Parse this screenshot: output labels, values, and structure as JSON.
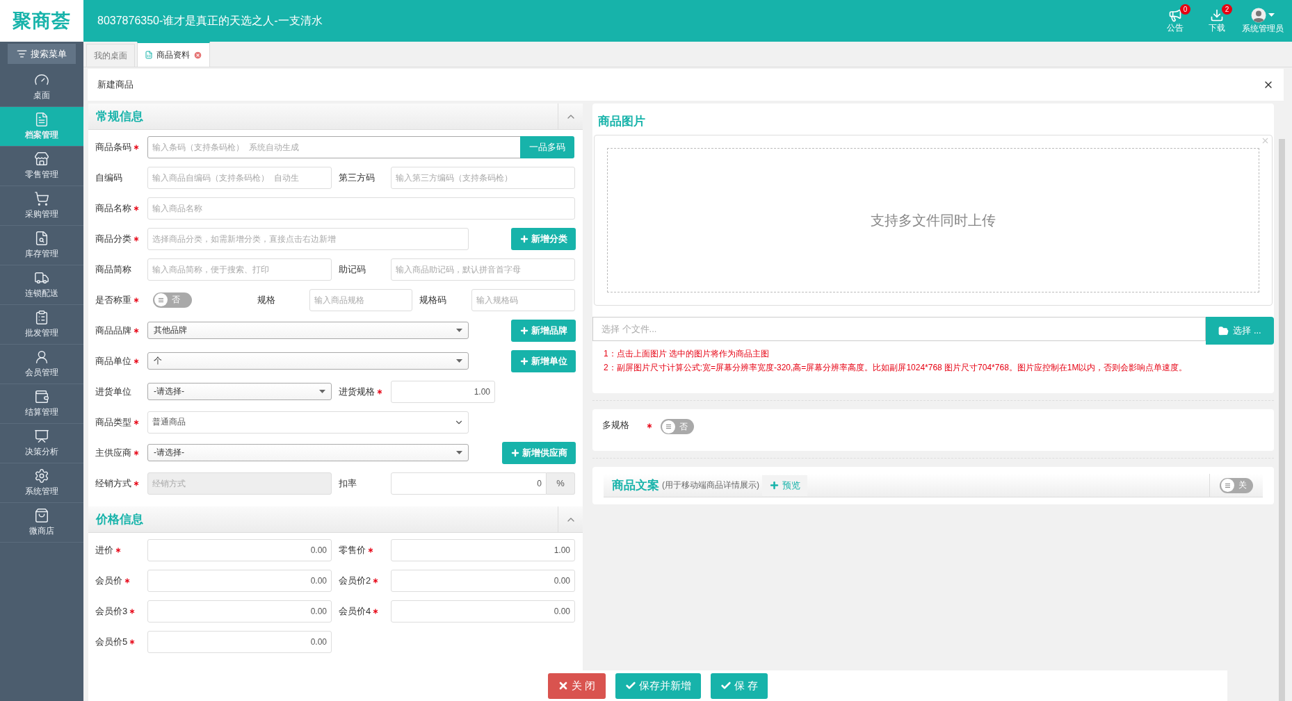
{
  "header": {
    "logo": "聚商荟",
    "title": "8037876350-谁才是真正的天选之人-一支清水",
    "actions": [
      {
        "label": "公告",
        "badge": "0"
      },
      {
        "label": "下载",
        "badge": "2"
      }
    ],
    "user": {
      "label": "系统管理员"
    }
  },
  "sidebar": {
    "search": "搜索菜单",
    "items": [
      {
        "label": "桌面",
        "selected": false
      },
      {
        "label": "档案管理",
        "selected": true
      },
      {
        "label": "零售管理",
        "selected": false
      },
      {
        "label": "采购管理",
        "selected": false
      },
      {
        "label": "库存管理",
        "selected": false
      },
      {
        "label": "连锁配送",
        "selected": false
      },
      {
        "label": "批发管理",
        "selected": false
      },
      {
        "label": "会员管理",
        "selected": false
      },
      {
        "label": "结算管理",
        "selected": false
      },
      {
        "label": "决策分析",
        "selected": false
      },
      {
        "label": "系统管理",
        "selected": false
      },
      {
        "label": "微商店",
        "selected": false
      }
    ]
  },
  "tabs": [
    {
      "label": "我的桌面",
      "selected": false,
      "closable": false
    },
    {
      "label": "商品资料",
      "selected": true,
      "closable": true
    }
  ],
  "panel": {
    "title": "新建商品"
  },
  "sections": [
    {
      "title": "常规信息",
      "expanded": true,
      "rows": [
        {
          "kind": "barcode",
          "fields": [
            {
              "label": "商品条码",
              "required": true,
              "control": {
                "kind": "input",
                "placeholder": "输入条码（支持条码枪）  系统自动生成"
              }
            }
          ],
          "button": "一品多码"
        },
        {
          "kind": "pair",
          "fields": [
            {
              "label": "自编码",
              "required": false,
              "control": {
                "kind": "input",
                "placeholder": "输入商品自编码（支持条码枪）  自动生"
              }
            },
            {
              "label": "第三方码",
              "required": false,
              "control": {
                "kind": "input",
                "placeholder": "输入第三方编码（支持条码枪）"
              }
            }
          ]
        },
        {
          "kind": "full",
          "fields": [
            {
              "label": "商品名称",
              "required": true,
              "control": {
                "kind": "input",
                "placeholder": "输入商品名称"
              }
            }
          ]
        },
        {
          "kind": "with-button",
          "fields": [
            {
              "label": "商品分类",
              "required": true,
              "control": {
                "kind": "input",
                "placeholder": "选择商品分类，如需新增分类，直接点击右边新增"
              }
            }
          ],
          "button": "新增分类"
        },
        {
          "kind": "pair",
          "fields": [
            {
              "label": "商品简称",
              "required": false,
              "control": {
                "kind": "input",
                "placeholder": "输入商品简称，便于搜索、打印"
              }
            },
            {
              "label": "助记码",
              "required": false,
              "control": {
                "kind": "input",
                "placeholder": "输入商品助记码，默认拼音首字母"
              }
            }
          ]
        },
        {
          "kind": "toggle-spec",
          "fields": [
            {
              "label": "是否称重",
              "required": true,
              "control": {
                "kind": "toggle",
                "on": false,
                "text": "否"
              }
            },
            {
              "label": "规格",
              "required": false,
              "control": {
                "kind": "input",
                "placeholder": "输入商品规格"
              }
            },
            {
              "label": "规格码",
              "required": false,
              "control": {
                "kind": "input",
                "placeholder": "输入规格码"
              }
            }
          ]
        },
        {
          "kind": "with-button",
          "fields": [
            {
              "label": "商品品牌",
              "required": true,
              "control": {
                "kind": "select",
                "value": "其他品牌"
              }
            }
          ],
          "button": "新增品牌"
        },
        {
          "kind": "with-button",
          "fields": [
            {
              "label": "商品单位",
              "required": true,
              "control": {
                "kind": "select",
                "value": "个"
              }
            }
          ],
          "button": "新增单位"
        },
        {
          "kind": "pair",
          "fields": [
            {
              "label": "进货单位",
              "required": false,
              "control": {
                "kind": "select",
                "value": "-请选择-"
              }
            },
            {
              "label": "进货规格",
              "required": true,
              "control": {
                "kind": "number",
                "value": "1.00"
              }
            }
          ]
        },
        {
          "kind": "with-button",
          "fields": [
            {
              "label": "商品类型",
              "required": true,
              "control": {
                "kind": "native-select",
                "value": "普通商品"
              }
            }
          ]
        },
        {
          "kind": "with-button",
          "fields": [
            {
              "label": "主供应商",
              "required": true,
              "control": {
                "kind": "select",
                "value": "-请选择-"
              }
            }
          ],
          "button": "新增供应商"
        },
        {
          "kind": "pair",
          "fields": [
            {
              "label": "经销方式",
              "required": true,
              "control": {
                "kind": "disabled",
                "placeholder": "经销方式"
              }
            },
            {
              "label": "扣率",
              "required": false,
              "control": {
                "kind": "percent",
                "value": "0",
                "addon": "%"
              }
            }
          ]
        }
      ]
    },
    {
      "title": "价格信息",
      "expanded": true,
      "rows": [
        {
          "kind": "pair",
          "fields": [
            {
              "label": "进价",
              "required": true,
              "control": {
                "kind": "number",
                "value": "0.00"
              }
            },
            {
              "label": "零售价",
              "required": true,
              "control": {
                "kind": "number",
                "value": "1.00"
              }
            }
          ]
        },
        {
          "kind": "pair",
          "fields": [
            {
              "label": "会员价",
              "required": true,
              "control": {
                "kind": "number",
                "value": "0.00"
              }
            },
            {
              "label": "会员价2",
              "required": true,
              "control": {
                "kind": "number",
                "value": "0.00"
              }
            }
          ]
        },
        {
          "kind": "pair",
          "fields": [
            {
              "label": "会员价3",
              "required": true,
              "control": {
                "kind": "number",
                "value": "0.00"
              }
            },
            {
              "label": "会员价4",
              "required": true,
              "control": {
                "kind": "number",
                "value": "0.00"
              }
            }
          ]
        },
        {
          "kind": "half",
          "fields": [
            {
              "label": "会员价5",
              "required": true,
              "control": {
                "kind": "number",
                "value": "0.00"
              }
            }
          ]
        }
      ]
    }
  ],
  "image_panel": {
    "title": "商品图片",
    "dropzone": "支持多文件同时上传",
    "file_placeholder": "选择 个文件...",
    "choose_button": "选择 ...",
    "notes": [
      "1：点击上面图片 选中的图片将作为商品主图",
      "2：副屏图片尺寸计算公式:宽=屏幕分辨率宽度-320,高=屏幕分辨率高度。比如副屏1024*768 图片尺寸704*768。图片应控制在1M以内，否则会影响点单速度。"
    ]
  },
  "multi_spec": {
    "label": "多规格",
    "required": true,
    "toggle": {
      "on": false,
      "text": "否"
    }
  },
  "copy_panel": {
    "title": "商品文案",
    "subtitle": "(用于移动端商品详情展示)",
    "preview": "预览",
    "toggle": {
      "on": false,
      "text": "关"
    }
  },
  "footer": {
    "buttons": [
      {
        "label": "关 闭",
        "kind": "danger"
      },
      {
        "label": "保存并新增",
        "kind": "primary"
      },
      {
        "label": "保 存",
        "kind": "primary"
      }
    ]
  }
}
